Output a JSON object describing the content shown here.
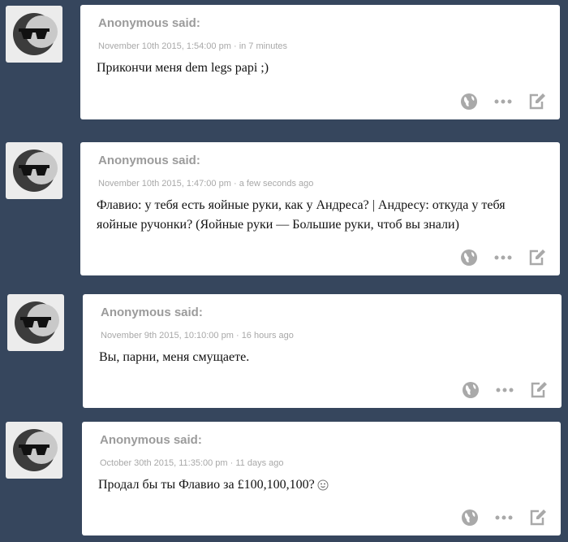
{
  "posts": [
    {
      "author": "Anonymous said:",
      "timestamp": "November 10th 2015, 1:54:00 pm",
      "relative": "in 7 minutes",
      "text": "Прикончи меня dem legs papi ;)"
    },
    {
      "author": "Anonymous said:",
      "timestamp": "November 10th 2015, 1:47:00 pm",
      "relative": "a few seconds ago",
      "text": "Флавио: у тебя есть яойные руки, как у Андреса? | Андресу: откуда у тебя яойные ручонки? (Яойные руки — Большие руки, чтоб вы знали)"
    },
    {
      "author": "Anonymous said:",
      "timestamp": "November 9th 2015, 10:10:00 pm",
      "relative": "16 hours ago",
      "text": "Вы, парни, меня смущаете."
    },
    {
      "author": "Anonymous said:",
      "timestamp": "October 30th 2015, 11:35:00 pm",
      "relative": "11 days ago",
      "text": "Продал бы ты Флавио за £100,100,100?"
    }
  ],
  "separator": "·",
  "icons": {
    "avatar": "sunglasses-avatar-icon",
    "globe": "globe-icon",
    "more": "ellipsis-icon",
    "edit": "edit-icon",
    "smiley": "smiley-icon"
  },
  "colors": {
    "background": "#36465d",
    "card": "#ffffff",
    "author": "#9b9b9b",
    "meta": "#a8a8a8",
    "icon": "#a9a9a9"
  }
}
